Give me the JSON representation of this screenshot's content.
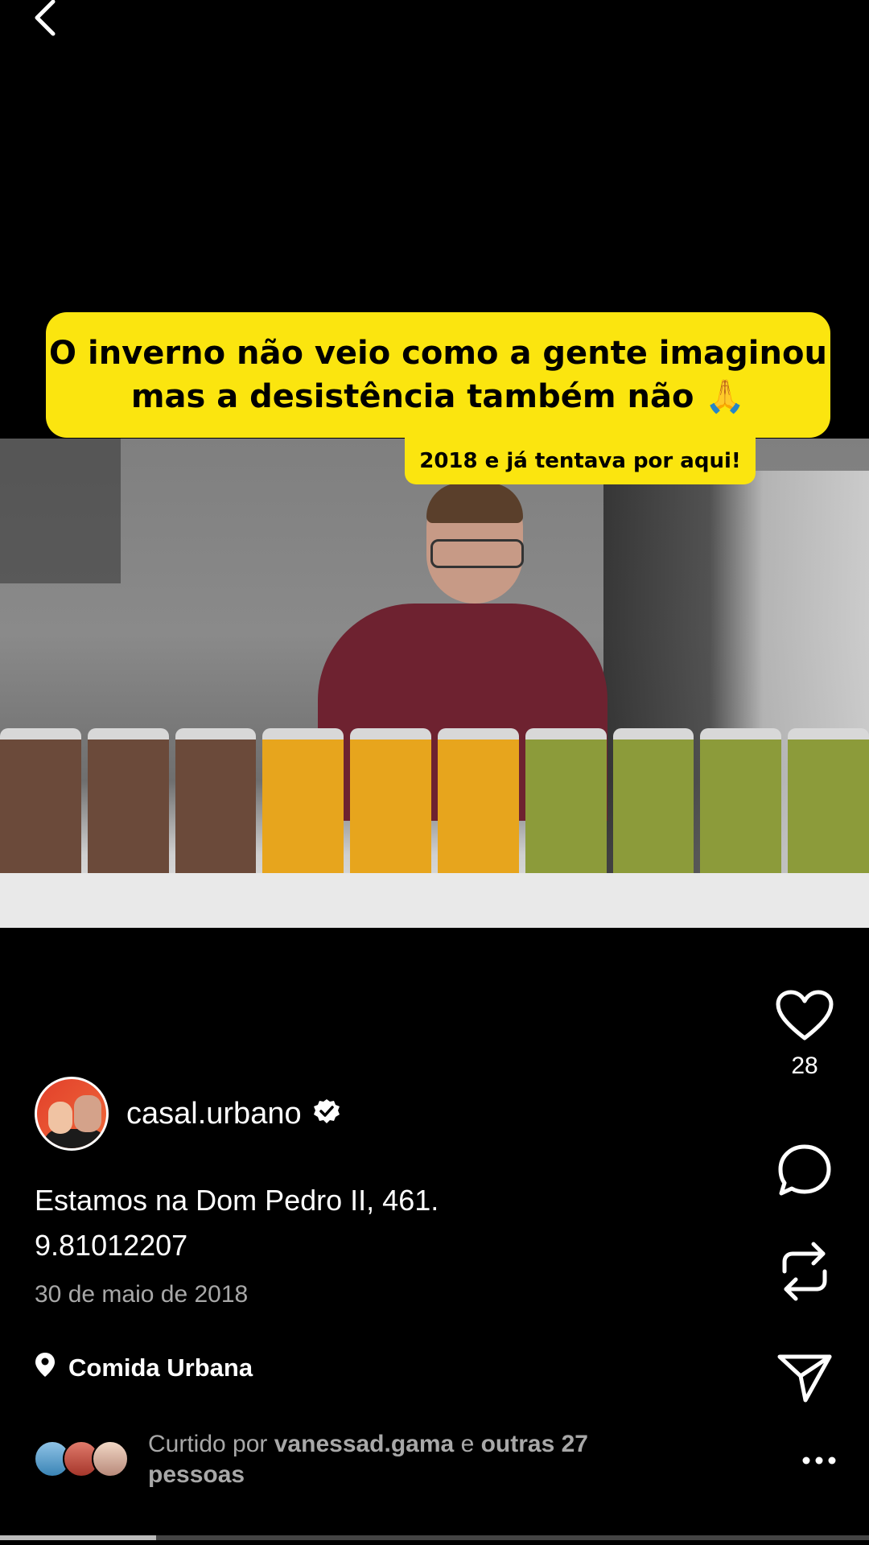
{
  "video": {
    "caption_line1": "O inverno não veio como a gente imaginou",
    "caption_line2": "mas a desistência também não 🙏",
    "sub_caption": "2018 e já tentava por aqui!",
    "progress": 0.18
  },
  "actions": {
    "like_count": "28"
  },
  "post": {
    "username": "casal.urbano",
    "description_line1": "Estamos na Dom Pedro II, 461.",
    "description_line2": "9.81012207",
    "date": "30 de maio de 2018",
    "location": "Comida Urbana",
    "liked_prefix": "Curtido por",
    "liked_user": "vanessad.gama",
    "liked_and": "e",
    "liked_others": "outras 27 pessoas"
  },
  "icons": {
    "back": "chevron-left-icon",
    "like": "heart-icon",
    "comment": "comment-bubble-icon",
    "repost": "repost-icon",
    "share": "send-icon",
    "more": "more-dots-icon",
    "location": "pin-icon",
    "verified": "verified-badge-icon"
  },
  "colors": {
    "caption_bg": "#fbe50f",
    "background": "#000000"
  }
}
